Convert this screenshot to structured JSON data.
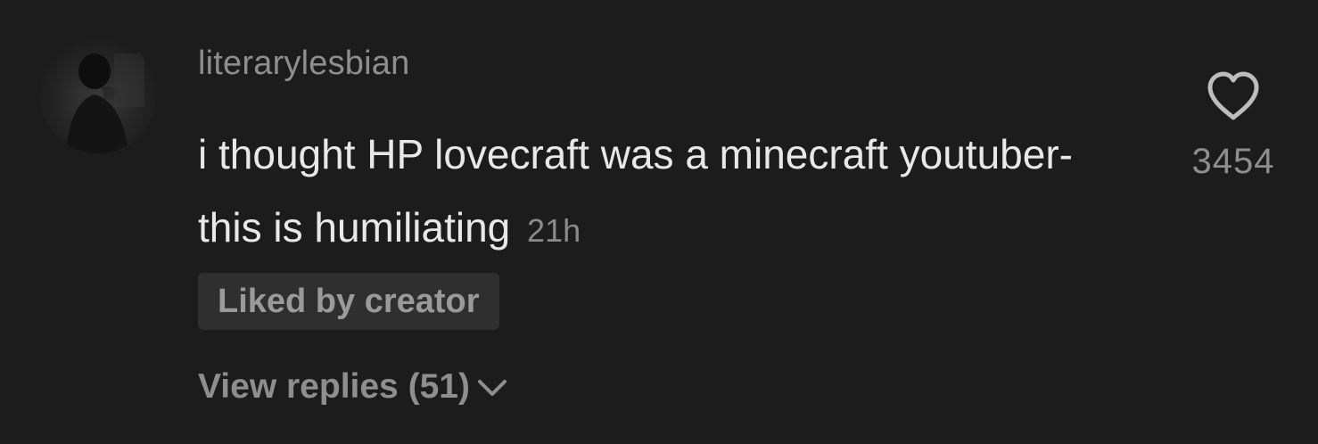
{
  "comment": {
    "username": "literarylesbian",
    "text": "i thought HP lovecraft was a minecraft youtuber- this is humiliating",
    "timestamp": "21h",
    "liked_by_creator_label": "Liked by creator",
    "view_replies_label": "View replies (51)",
    "like_count": "3454",
    "avatar_icon": "profile-photo",
    "heart_icon": "heart-outline-icon",
    "chevron_icon": "chevron-down-icon"
  },
  "colors": {
    "background": "#1c1c1c",
    "username": "#8e8e8e",
    "text": "#e8e8e8",
    "muted": "#8e8e8e",
    "badge_bg": "#2f2f2f"
  }
}
